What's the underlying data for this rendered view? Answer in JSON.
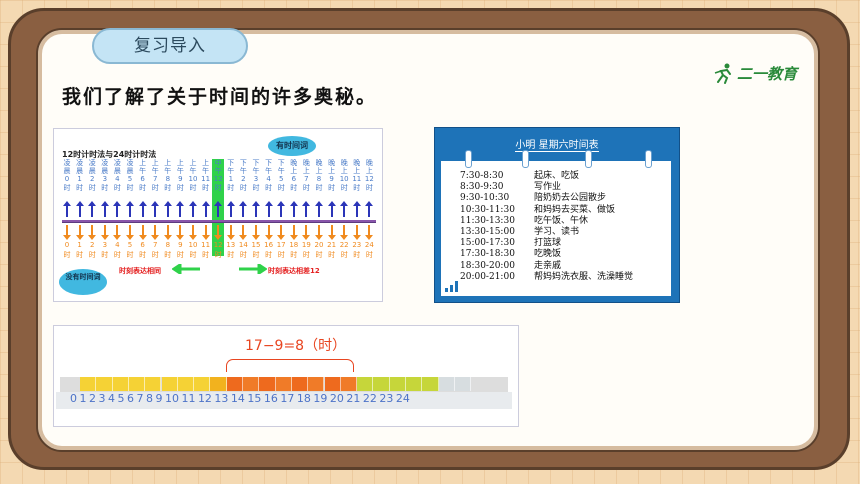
{
  "header": {
    "pill": "复习导入",
    "logo": "二一教育"
  },
  "intro": "我们了解了关于时间的许多奥秘。",
  "clock_chart": {
    "title": "12时计时法与24时计时法",
    "bubble_top": "有时间词",
    "bubble_bottom": "没有时间词",
    "note_left": "时刻表达相同",
    "note_right": "时刻表达相差12",
    "top_words": [
      "凌晨",
      "凌晨",
      "凌晨",
      "凌晨",
      "凌晨",
      "凌晨",
      "上午",
      "上午",
      "上午",
      "上午",
      "上午",
      "上午",
      "中午",
      "下午",
      "下午",
      "下午",
      "下午",
      "下午",
      "晚上",
      "晚上",
      "晚上",
      "晚上",
      "晚上",
      "晚上"
    ],
    "hours12": [
      "0",
      "1",
      "2",
      "3",
      "4",
      "5",
      "6",
      "7",
      "8",
      "9",
      "10",
      "11",
      "12",
      "1",
      "2",
      "3",
      "4",
      "5",
      "6",
      "7",
      "8",
      "9",
      "10",
      "11",
      "12"
    ],
    "hours24": [
      "0",
      "1",
      "2",
      "3",
      "4",
      "5",
      "6",
      "7",
      "8",
      "9",
      "10",
      "11",
      "12",
      "13",
      "14",
      "15",
      "16",
      "17",
      "18",
      "19",
      "20",
      "21",
      "22",
      "23",
      "24"
    ],
    "unit": "时"
  },
  "schedule": {
    "title": "小明 星期六时间表",
    "rows": [
      {
        "time": "7:30-8:30",
        "task": "起床、吃饭"
      },
      {
        "time": "8:30-9:30",
        "task": "写作业"
      },
      {
        "time": "9:30-10:30",
        "task": "陪奶奶去公园散步"
      },
      {
        "time": "10:30-11:30",
        "task": "和妈妈去买菜、做饭"
      },
      {
        "time": "11:30-13:30",
        "task": "吃午饭、午休"
      },
      {
        "time": "13:30-15:00",
        "task": "学习、读书"
      },
      {
        "time": "15:00-17:30",
        "task": "打篮球"
      },
      {
        "time": "17:30-18:30",
        "task": "吃晚饭"
      },
      {
        "time": "18:30-20:00",
        "task": "走亲戚"
      },
      {
        "time": "20:00-21:00",
        "task": "帮妈妈洗衣服、洗澡睡觉"
      }
    ]
  },
  "ruler": {
    "formula": "17−9=8（时）",
    "ticks": "0 1 2 3 4 5 6 7 8 9 10 11 12 13 14 15 16 17 18 19 20 21 22 23 24"
  }
}
